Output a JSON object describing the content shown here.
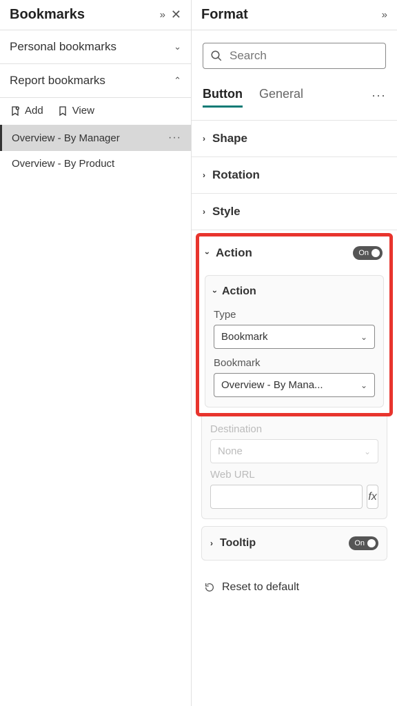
{
  "bookmarks": {
    "title": "Bookmarks",
    "personal": {
      "label": "Personal bookmarks"
    },
    "report": {
      "label": "Report bookmarks"
    },
    "toolbar": {
      "add": "Add",
      "view": "View"
    },
    "items": [
      {
        "label": "Overview - By Manager",
        "selected": true
      },
      {
        "label": "Overview - By Product",
        "selected": false
      }
    ]
  },
  "format": {
    "title": "Format",
    "search_placeholder": "Search",
    "tabs": {
      "button": "Button",
      "general": "General"
    },
    "rows": {
      "shape": "Shape",
      "rotation": "Rotation",
      "style": "Style"
    },
    "action": {
      "label": "Action",
      "toggle": "On",
      "card_label": "Action",
      "type_label": "Type",
      "type_value": "Bookmark",
      "bookmark_label": "Bookmark",
      "bookmark_value": "Overview - By Mana...",
      "destination_label": "Destination",
      "destination_value": "None",
      "weburl_label": "Web URL",
      "fx": "fx"
    },
    "tooltip": {
      "label": "Tooltip",
      "toggle": "On"
    },
    "reset": "Reset to default"
  }
}
